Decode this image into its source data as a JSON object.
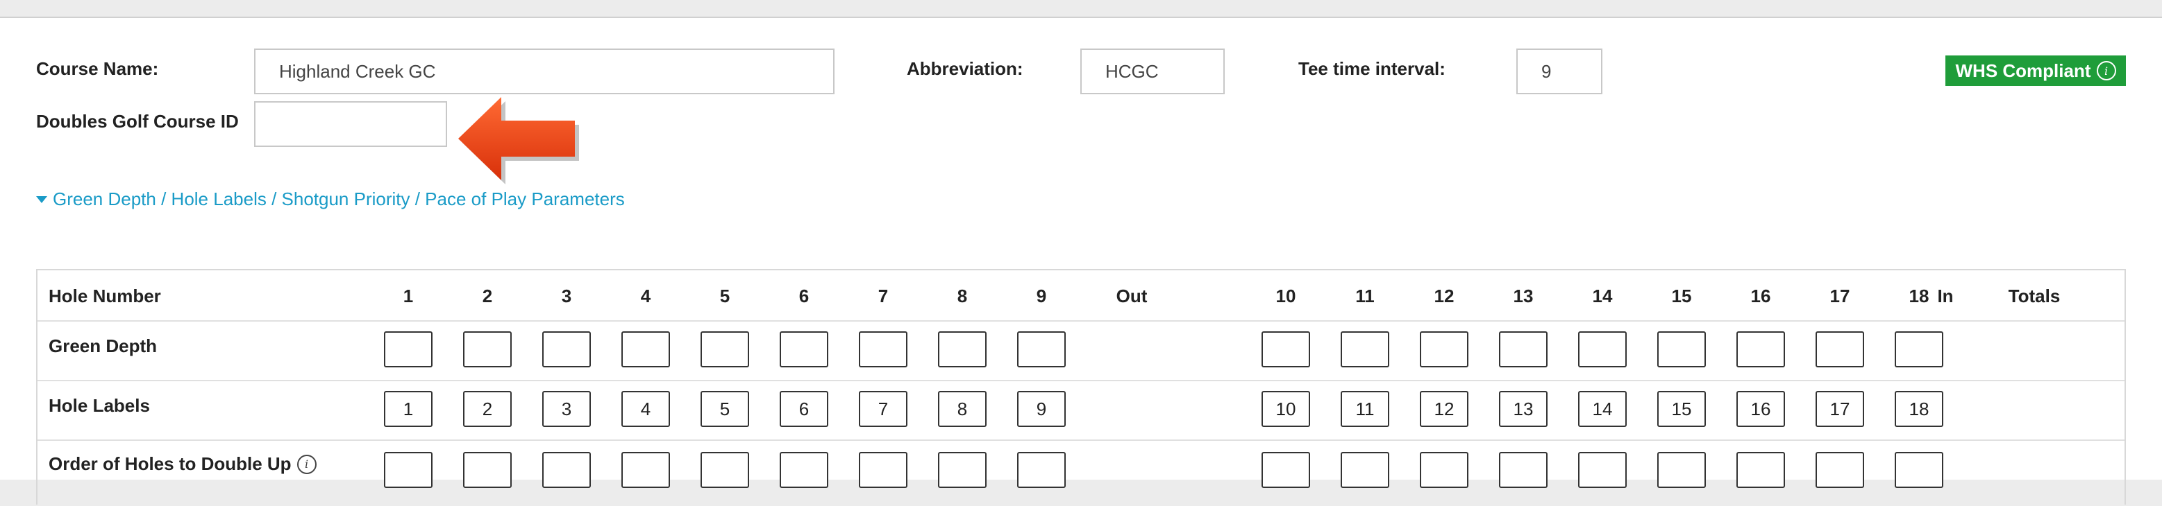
{
  "form": {
    "course_name_label": "Course Name:",
    "course_name_value": "Highland Creek GC",
    "abbreviation_label": "Abbreviation:",
    "abbreviation_value": "HCGC",
    "tee_interval_label": "Tee time interval:",
    "tee_interval_value": "9",
    "doubles_id_label": "Doubles Golf Course ID",
    "doubles_id_value": "",
    "whs_badge": "WHS Compliant",
    "expander_label": "Green Depth / Hole Labels / Shotgun Priority / Pace of Play Parameters"
  },
  "icons": {
    "info": "i",
    "arrow_color": "#e8420f",
    "badge_color": "#1f9d3a",
    "link_color": "#1a9bc7"
  },
  "table": {
    "header": {
      "label": "Hole Number",
      "holes_front": [
        "1",
        "2",
        "3",
        "4",
        "5",
        "6",
        "7",
        "8",
        "9"
      ],
      "out": "Out",
      "holes_back": [
        "10",
        "11",
        "12",
        "13",
        "14",
        "15",
        "16",
        "17",
        "18"
      ],
      "in": "In",
      "totals": "Totals"
    },
    "rows": {
      "green_depth": {
        "label": "Green Depth",
        "values": [
          "",
          "",
          "",
          "",
          "",
          "",
          "",
          "",
          "",
          "",
          "",
          "",
          "",
          "",
          "",
          "",
          "",
          ""
        ]
      },
      "hole_labels": {
        "label": "Hole Labels",
        "values": [
          "1",
          "2",
          "3",
          "4",
          "5",
          "6",
          "7",
          "8",
          "9",
          "10",
          "11",
          "12",
          "13",
          "14",
          "15",
          "16",
          "17",
          "18"
        ]
      },
      "double_up": {
        "label": "Order of Holes to Double Up",
        "values": [
          "",
          "",
          "",
          "",
          "",
          "",
          "",
          "",
          "",
          "",
          "",
          "",
          "",
          "",
          "",
          "",
          "",
          ""
        ]
      }
    }
  }
}
